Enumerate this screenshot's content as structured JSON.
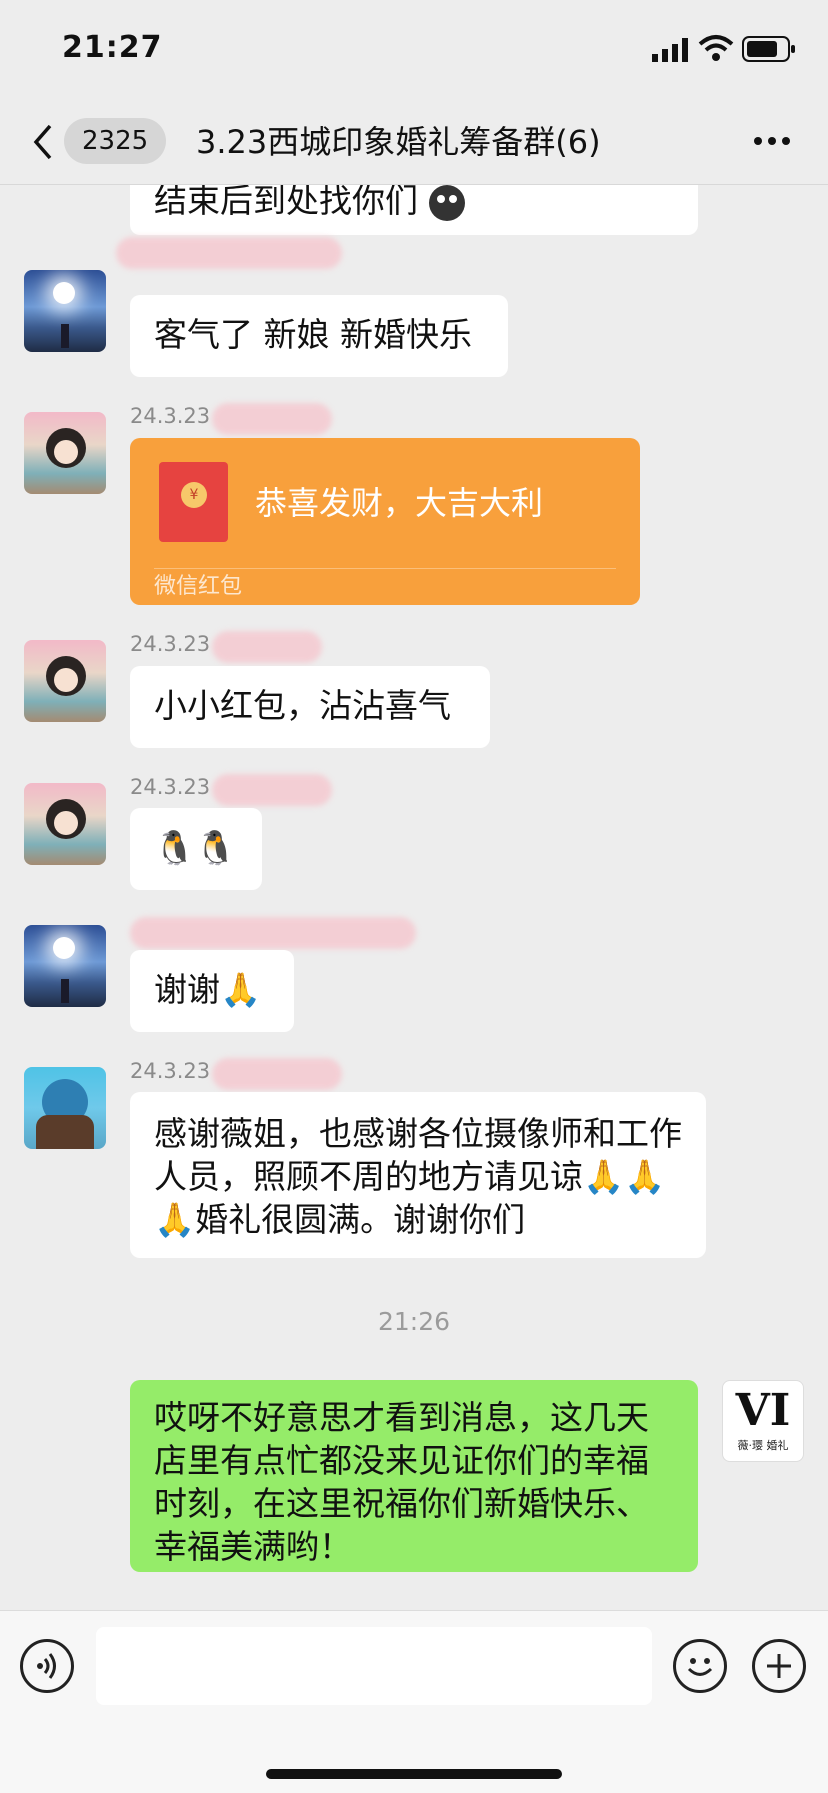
{
  "status": {
    "time": "21:27"
  },
  "nav": {
    "unread_count": "2325",
    "title": "3.23西城印象婚礼筹备群(6)"
  },
  "messages": [
    {
      "text": "结束后到处找你们"
    },
    {
      "text": "客气了 新娘 新婚快乐"
    },
    {
      "date": "24.3.23",
      "redpacket_text": "恭喜发财，大吉大利",
      "redpacket_label": "微信红包",
      "coin": "¥"
    },
    {
      "date": "24.3.23",
      "text": "小小红包，沾沾喜气"
    },
    {
      "date": "24.3.23",
      "emoji": "🐧🐧"
    },
    {
      "text": "谢谢🙏"
    },
    {
      "date": "24.3.23",
      "text": "感谢薇姐，也感谢各位摄像师和工作人员，照顾不周的地方请见谅🙏🙏🙏婚礼很圆满。谢谢你们"
    },
    {
      "time_divider": "21:26"
    },
    {
      "text": "哎呀不好意思才看到消息，这几天店里有点忙都没来见证你们的幸福时刻，在这里祝福你们新婚快乐、幸福美满哟！"
    }
  ],
  "own_avatar": {
    "logo_letters": "VI",
    "logo_caption": "薇·璎 婚礼"
  },
  "icons": [
    "back-icon",
    "more-icon",
    "voice-icon",
    "emoji-icon",
    "plus-icon",
    "signal-icon",
    "wifi-icon",
    "battery-icon"
  ]
}
